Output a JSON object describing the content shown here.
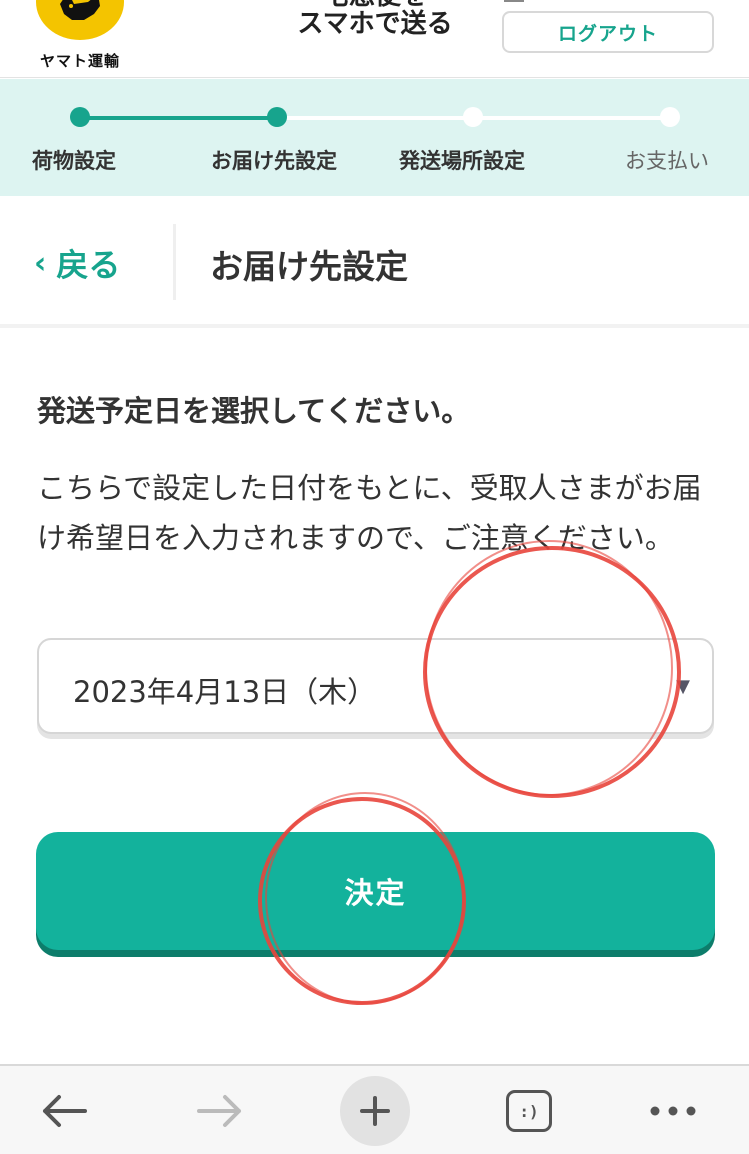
{
  "header": {
    "logo_text": "ヤマト運輸",
    "brand_line1": "宅急便を",
    "brand_line2": "スマホで送る",
    "logout_label": "ログアウト"
  },
  "progress": {
    "steps": [
      {
        "label": "荷物設定",
        "state": "done"
      },
      {
        "label": "お届け先設定",
        "state": "current"
      },
      {
        "label": "発送場所設定",
        "state": "todo"
      },
      {
        "label": "お支払い",
        "state": "todo"
      }
    ]
  },
  "titlebar": {
    "back_label": "戻る",
    "page_title": "お届け先設定"
  },
  "content": {
    "heading": "発送予定日を選択してください。",
    "description": "こちらで設定した日付をもとに、受取人さまがお届け希望日を入力されますので、ご注意ください。",
    "date_select_value": "2023年4月13日（木）",
    "submit_label": "決定"
  },
  "browser_toolbar": {
    "tabs_label": ":)"
  },
  "colors": {
    "accent": "#17a48d",
    "button": "#13b29c",
    "progress_bg": "#ddf4f1",
    "annotation": "#e8453c"
  }
}
